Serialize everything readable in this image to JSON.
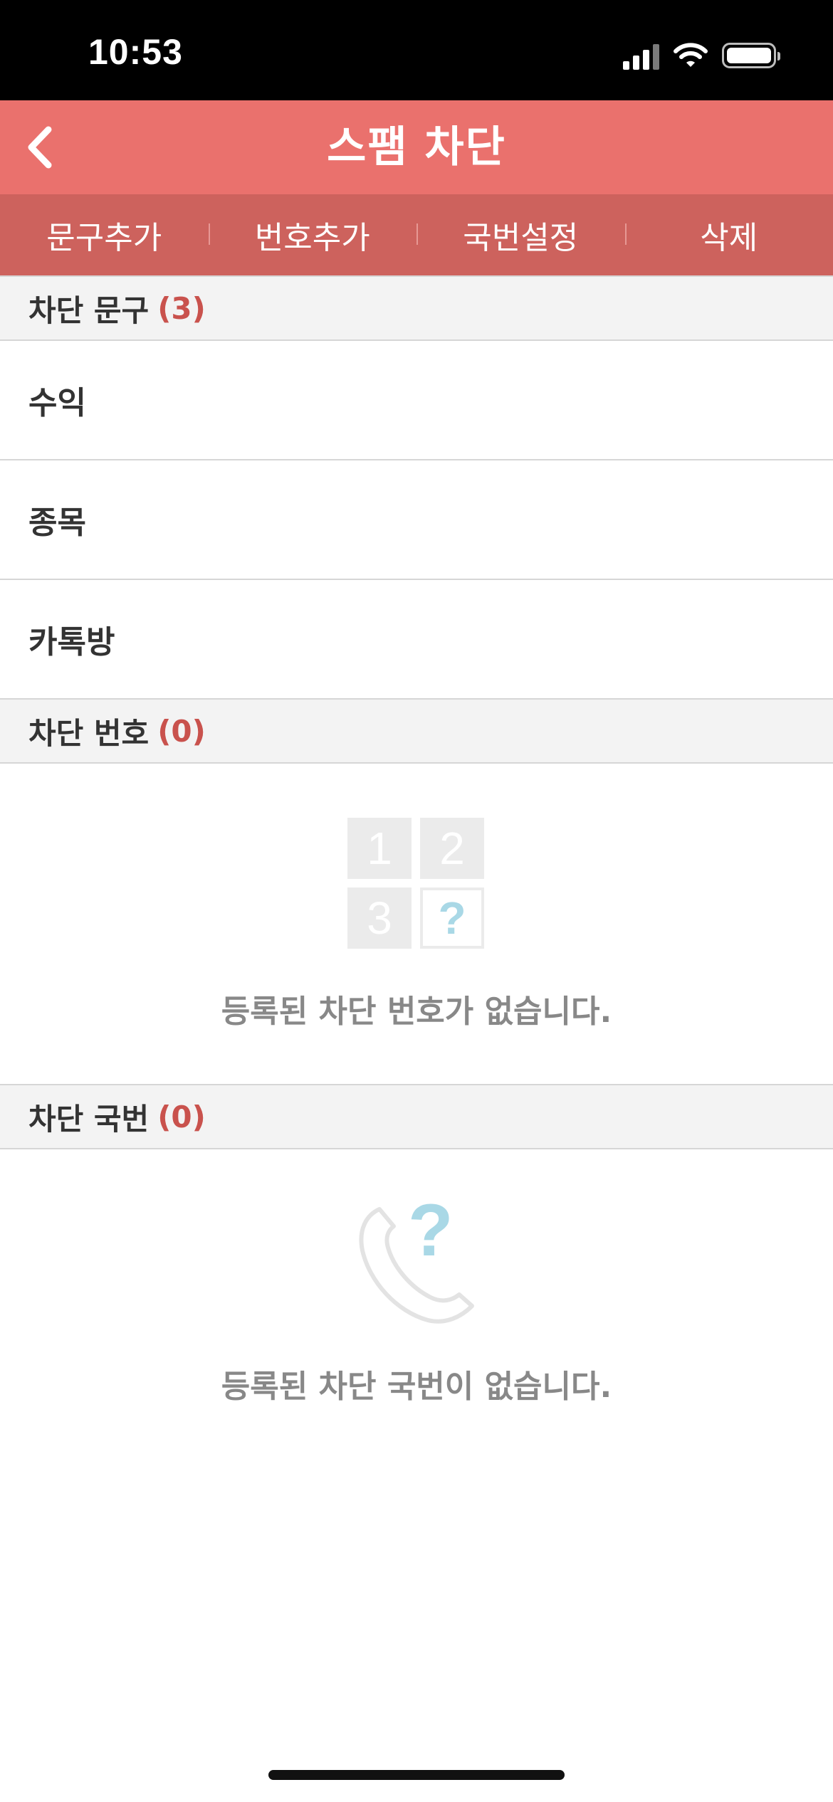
{
  "status_bar": {
    "time": "10:53"
  },
  "header": {
    "title": "스팸 차단",
    "back_icon": "chevron-left-icon"
  },
  "tabs": [
    "문구추가",
    "번호추가",
    "국번설정",
    "삭제"
  ],
  "sections": {
    "phrases": {
      "title": "차단 문구",
      "count": "(3)",
      "items": [
        "수익",
        "종목",
        "카톡방"
      ]
    },
    "numbers": {
      "title": "차단 번호",
      "count": "(0)",
      "empty_icon_digits": [
        "1",
        "2",
        "3",
        "?"
      ],
      "empty_text": "등록된 차단 번호가 없습니다."
    },
    "prefixes": {
      "title": "차단 국번",
      "count": "(0)",
      "empty_icon_mark": "?",
      "empty_text": "등록된 차단 국번이 없습니다."
    }
  },
  "colors": {
    "header": "#ea716d",
    "tabbar": "#cd625d",
    "count": "#c9524d",
    "question_mark": "#a9d8e6"
  }
}
